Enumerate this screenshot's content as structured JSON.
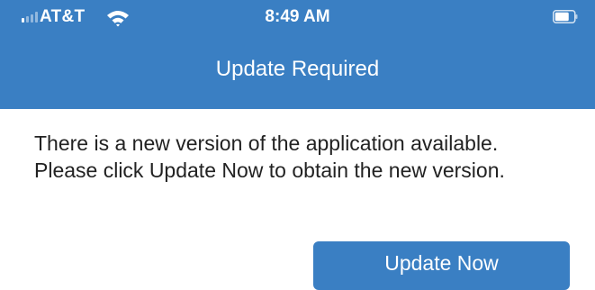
{
  "status_bar": {
    "carrier": "AT&T",
    "time": "8:49 AM",
    "signal_icon": "cellular-signal-icon",
    "wifi_icon": "wifi-icon",
    "battery_icon": "battery-icon"
  },
  "nav": {
    "title": "Update Required"
  },
  "body": {
    "message": "There is a new version of the application available. Please click Update Now to obtain the new version."
  },
  "actions": {
    "update_label": "Update Now"
  },
  "colors": {
    "header_bg": "#3a7fc3",
    "button_bg": "#3a7fc3",
    "text": "#222222"
  }
}
